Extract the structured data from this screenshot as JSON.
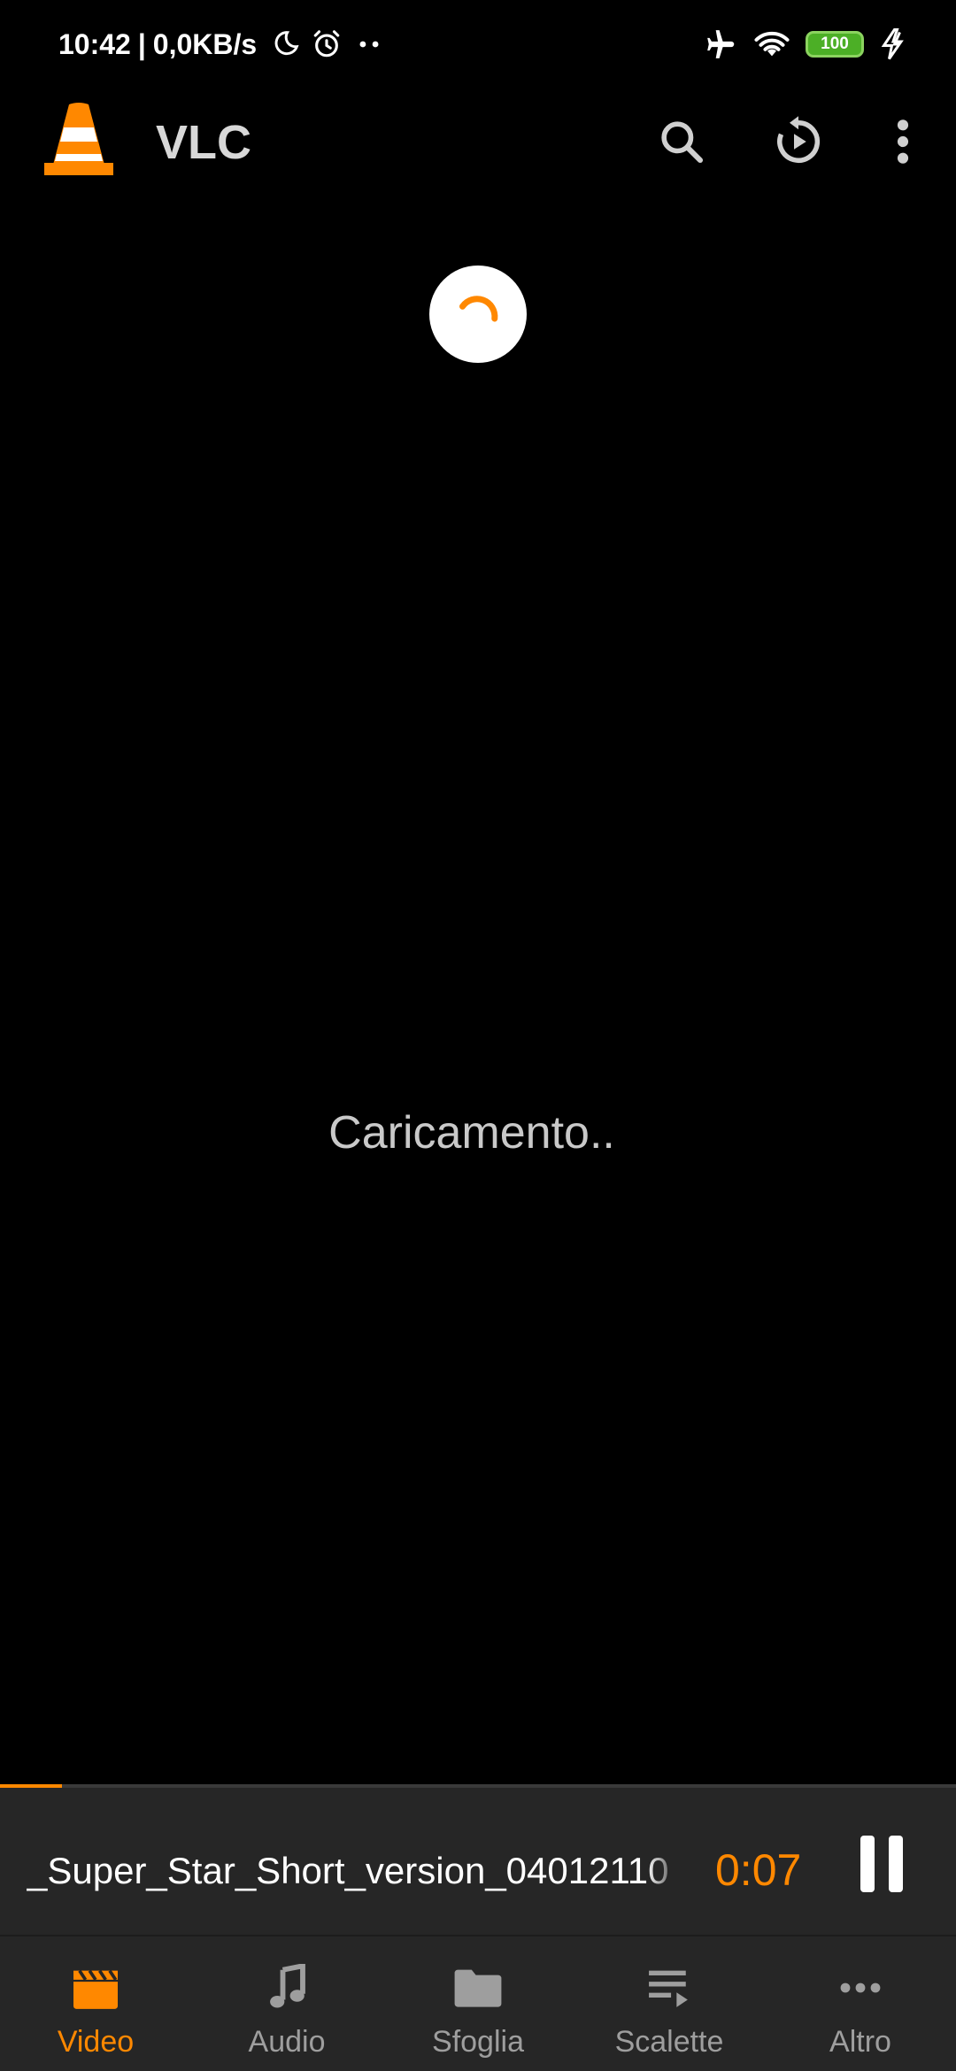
{
  "status_bar": {
    "time": "10:42",
    "separator": "|",
    "network_speed": "0,0KB/s",
    "battery_level": "100",
    "icons_left": [
      "moon-icon",
      "alarm-icon",
      "more-dots-icon"
    ],
    "icons_right": [
      "airplane-icon",
      "wifi-icon",
      "battery-icon",
      "charging-icon"
    ]
  },
  "app_bar": {
    "title": "VLC",
    "actions": [
      "search-icon",
      "resume-playback-icon",
      "overflow-menu-icon"
    ]
  },
  "main": {
    "loading_text": "Caricamento.."
  },
  "mini_player": {
    "title": "_Super_Star_Short_version_04012110",
    "time": "0:07",
    "progress": 0.065,
    "accent_color": "#ff8800"
  },
  "bottom_nav": {
    "items": [
      {
        "label": "Video",
        "icon": "video-clapper-icon",
        "active": true
      },
      {
        "label": "Audio",
        "icon": "music-note-icon",
        "active": false
      },
      {
        "label": "Sfoglia",
        "icon": "folder-icon",
        "active": false
      },
      {
        "label": "Scalette",
        "icon": "playlist-icon",
        "active": false
      },
      {
        "label": "Altro",
        "icon": "more-horizontal-icon",
        "active": false
      }
    ]
  }
}
